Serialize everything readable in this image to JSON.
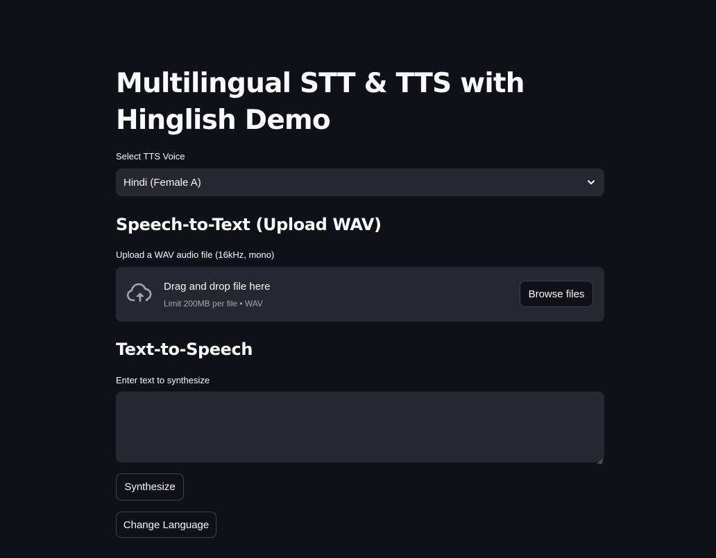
{
  "title": "Multilingual STT & TTS with Hinglish Demo",
  "voice_select": {
    "label": "Select TTS Voice",
    "value": "Hindi (Female A)",
    "icon": "chevron-down-icon"
  },
  "stt": {
    "heading": "Speech-to-Text (Upload WAV)",
    "uploader_label": "Upload a WAV audio file (16kHz, mono)",
    "drop_text": "Drag and drop file here",
    "limit_text": "Limit 200MB per file • WAV",
    "browse_label": "Browse files",
    "icon": "cloud-upload-icon"
  },
  "tts": {
    "heading": "Text-to-Speech",
    "text_label": "Enter text to synthesize",
    "text_value": "",
    "synthesize_label": "Synthesize",
    "change_language_label": "Change Language"
  },
  "colors": {
    "background": "#0e1117",
    "surface": "#262730",
    "text": "#fafafa",
    "muted_text": "#a3a8b4"
  }
}
